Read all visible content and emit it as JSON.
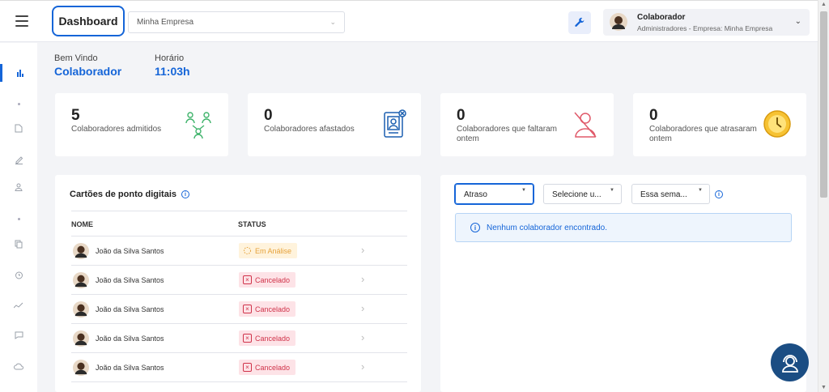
{
  "header": {
    "title": "Dashboard",
    "company_select": "Minha Empresa",
    "user_name": "Colaborador",
    "user_role": "Administradores - Empresa: Minha Empresa"
  },
  "welcome": {
    "greeting_label": "Bem Vindo",
    "greeting_value": "Colaborador",
    "time_label": "Horário",
    "time_value": "11:03h"
  },
  "stats": [
    {
      "value": "5",
      "label": "Colaboradores admitidos",
      "icon": "people-network-icon"
    },
    {
      "value": "0",
      "label": "Colaboradores afastados",
      "icon": "id-badge-icon"
    },
    {
      "value": "0",
      "label": "Colaboradores que faltaram ontem",
      "icon": "person-absent-icon"
    },
    {
      "value": "0",
      "label": "Colaboradores que atrasaram ontem",
      "icon": "clock-icon"
    }
  ],
  "timecards": {
    "title": "Cartões de ponto digitais",
    "columns": [
      "NOME",
      "STATUS"
    ],
    "rows": [
      {
        "name": "João da Silva Santos",
        "status": "Em Análise",
        "type": "warn"
      },
      {
        "name": "João da Silva Santos",
        "status": "Cancelado",
        "type": "err"
      },
      {
        "name": "João da Silva Santos",
        "status": "Cancelado",
        "type": "err"
      },
      {
        "name": "João da Silva Santos",
        "status": "Cancelado",
        "type": "err"
      },
      {
        "name": "João da Silva Santos",
        "status": "Cancelado",
        "type": "err"
      }
    ]
  },
  "filters": {
    "type": "Atraso",
    "select": "Selecione u...",
    "period": "Essa sema..."
  },
  "alert": "Nenhum colaborador encontrado.",
  "colors": {
    "accent": "#1565d8",
    "warn": "#e6a23c",
    "error": "#d0334a"
  }
}
